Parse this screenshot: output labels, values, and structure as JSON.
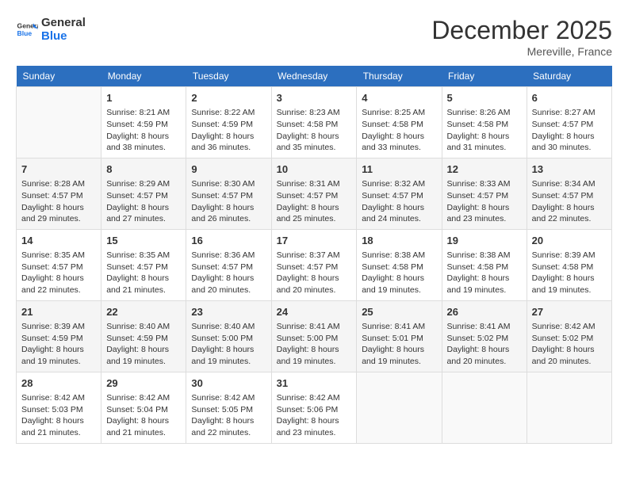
{
  "logo": {
    "line1": "General",
    "line2": "Blue"
  },
  "title": "December 2025",
  "location": "Mereville, France",
  "days_of_week": [
    "Sunday",
    "Monday",
    "Tuesday",
    "Wednesday",
    "Thursday",
    "Friday",
    "Saturday"
  ],
  "weeks": [
    [
      {
        "day": "",
        "info": ""
      },
      {
        "day": "1",
        "info": "Sunrise: 8:21 AM\nSunset: 4:59 PM\nDaylight: 8 hours\nand 38 minutes."
      },
      {
        "day": "2",
        "info": "Sunrise: 8:22 AM\nSunset: 4:59 PM\nDaylight: 8 hours\nand 36 minutes."
      },
      {
        "day": "3",
        "info": "Sunrise: 8:23 AM\nSunset: 4:58 PM\nDaylight: 8 hours\nand 35 minutes."
      },
      {
        "day": "4",
        "info": "Sunrise: 8:25 AM\nSunset: 4:58 PM\nDaylight: 8 hours\nand 33 minutes."
      },
      {
        "day": "5",
        "info": "Sunrise: 8:26 AM\nSunset: 4:58 PM\nDaylight: 8 hours\nand 31 minutes."
      },
      {
        "day": "6",
        "info": "Sunrise: 8:27 AM\nSunset: 4:57 PM\nDaylight: 8 hours\nand 30 minutes."
      }
    ],
    [
      {
        "day": "7",
        "info": "Sunrise: 8:28 AM\nSunset: 4:57 PM\nDaylight: 8 hours\nand 29 minutes."
      },
      {
        "day": "8",
        "info": "Sunrise: 8:29 AM\nSunset: 4:57 PM\nDaylight: 8 hours\nand 27 minutes."
      },
      {
        "day": "9",
        "info": "Sunrise: 8:30 AM\nSunset: 4:57 PM\nDaylight: 8 hours\nand 26 minutes."
      },
      {
        "day": "10",
        "info": "Sunrise: 8:31 AM\nSunset: 4:57 PM\nDaylight: 8 hours\nand 25 minutes."
      },
      {
        "day": "11",
        "info": "Sunrise: 8:32 AM\nSunset: 4:57 PM\nDaylight: 8 hours\nand 24 minutes."
      },
      {
        "day": "12",
        "info": "Sunrise: 8:33 AM\nSunset: 4:57 PM\nDaylight: 8 hours\nand 23 minutes."
      },
      {
        "day": "13",
        "info": "Sunrise: 8:34 AM\nSunset: 4:57 PM\nDaylight: 8 hours\nand 22 minutes."
      }
    ],
    [
      {
        "day": "14",
        "info": "Sunrise: 8:35 AM\nSunset: 4:57 PM\nDaylight: 8 hours\nand 22 minutes."
      },
      {
        "day": "15",
        "info": "Sunrise: 8:35 AM\nSunset: 4:57 PM\nDaylight: 8 hours\nand 21 minutes."
      },
      {
        "day": "16",
        "info": "Sunrise: 8:36 AM\nSunset: 4:57 PM\nDaylight: 8 hours\nand 20 minutes."
      },
      {
        "day": "17",
        "info": "Sunrise: 8:37 AM\nSunset: 4:57 PM\nDaylight: 8 hours\nand 20 minutes."
      },
      {
        "day": "18",
        "info": "Sunrise: 8:38 AM\nSunset: 4:58 PM\nDaylight: 8 hours\nand 19 minutes."
      },
      {
        "day": "19",
        "info": "Sunrise: 8:38 AM\nSunset: 4:58 PM\nDaylight: 8 hours\nand 19 minutes."
      },
      {
        "day": "20",
        "info": "Sunrise: 8:39 AM\nSunset: 4:58 PM\nDaylight: 8 hours\nand 19 minutes."
      }
    ],
    [
      {
        "day": "21",
        "info": "Sunrise: 8:39 AM\nSunset: 4:59 PM\nDaylight: 8 hours\nand 19 minutes."
      },
      {
        "day": "22",
        "info": "Sunrise: 8:40 AM\nSunset: 4:59 PM\nDaylight: 8 hours\nand 19 minutes."
      },
      {
        "day": "23",
        "info": "Sunrise: 8:40 AM\nSunset: 5:00 PM\nDaylight: 8 hours\nand 19 minutes."
      },
      {
        "day": "24",
        "info": "Sunrise: 8:41 AM\nSunset: 5:00 PM\nDaylight: 8 hours\nand 19 minutes."
      },
      {
        "day": "25",
        "info": "Sunrise: 8:41 AM\nSunset: 5:01 PM\nDaylight: 8 hours\nand 19 minutes."
      },
      {
        "day": "26",
        "info": "Sunrise: 8:41 AM\nSunset: 5:02 PM\nDaylight: 8 hours\nand 20 minutes."
      },
      {
        "day": "27",
        "info": "Sunrise: 8:42 AM\nSunset: 5:02 PM\nDaylight: 8 hours\nand 20 minutes."
      }
    ],
    [
      {
        "day": "28",
        "info": "Sunrise: 8:42 AM\nSunset: 5:03 PM\nDaylight: 8 hours\nand 21 minutes."
      },
      {
        "day": "29",
        "info": "Sunrise: 8:42 AM\nSunset: 5:04 PM\nDaylight: 8 hours\nand 21 minutes."
      },
      {
        "day": "30",
        "info": "Sunrise: 8:42 AM\nSunset: 5:05 PM\nDaylight: 8 hours\nand 22 minutes."
      },
      {
        "day": "31",
        "info": "Sunrise: 8:42 AM\nSunset: 5:06 PM\nDaylight: 8 hours\nand 23 minutes."
      },
      {
        "day": "",
        "info": ""
      },
      {
        "day": "",
        "info": ""
      },
      {
        "day": "",
        "info": ""
      }
    ]
  ]
}
